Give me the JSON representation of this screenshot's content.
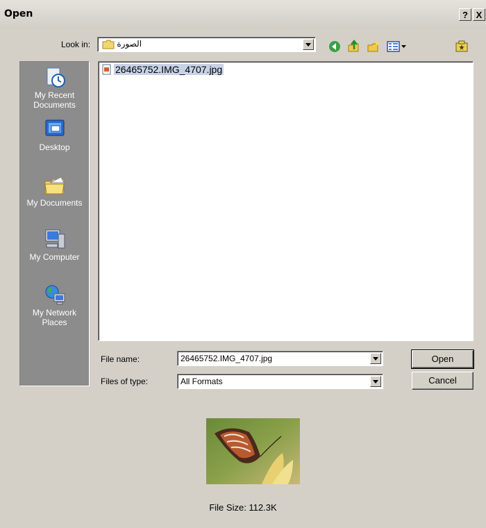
{
  "window": {
    "title": "Open",
    "help_label": "?",
    "close_label": "X"
  },
  "lookin": {
    "label": "Look in:",
    "value": "الصورة",
    "folder_icon": "folder-icon"
  },
  "toolbar": {
    "icons": [
      "back-icon",
      "up-folder-icon",
      "new-folder-icon",
      "view-menu-icon",
      "favorites-icon"
    ]
  },
  "places": [
    {
      "label": "My Recent Documents",
      "icon": "recent-documents-icon"
    },
    {
      "label": "Desktop",
      "icon": "desktop-icon"
    },
    {
      "label": "My Documents",
      "icon": "my-documents-icon"
    },
    {
      "label": "My Computer",
      "icon": "my-computer-icon"
    },
    {
      "label": "My Network Places",
      "icon": "network-places-icon"
    }
  ],
  "files": [
    {
      "name": "26465752.IMG_4707.jpg",
      "selected": true
    }
  ],
  "filename": {
    "label": "File name:",
    "value": "26465752.IMG_4707.jpg"
  },
  "filetype": {
    "label": "Files of type:",
    "value": "All Formats"
  },
  "buttons": {
    "open": "Open",
    "cancel": "Cancel"
  },
  "preview": {
    "image_desc": "butterfly-photo",
    "file_size": "File Size: 112.3K"
  },
  "colors": {
    "places_bg": "#8c8c8c",
    "selection": "#c8d2e6",
    "dialog_bg": "#d4d0c8"
  }
}
